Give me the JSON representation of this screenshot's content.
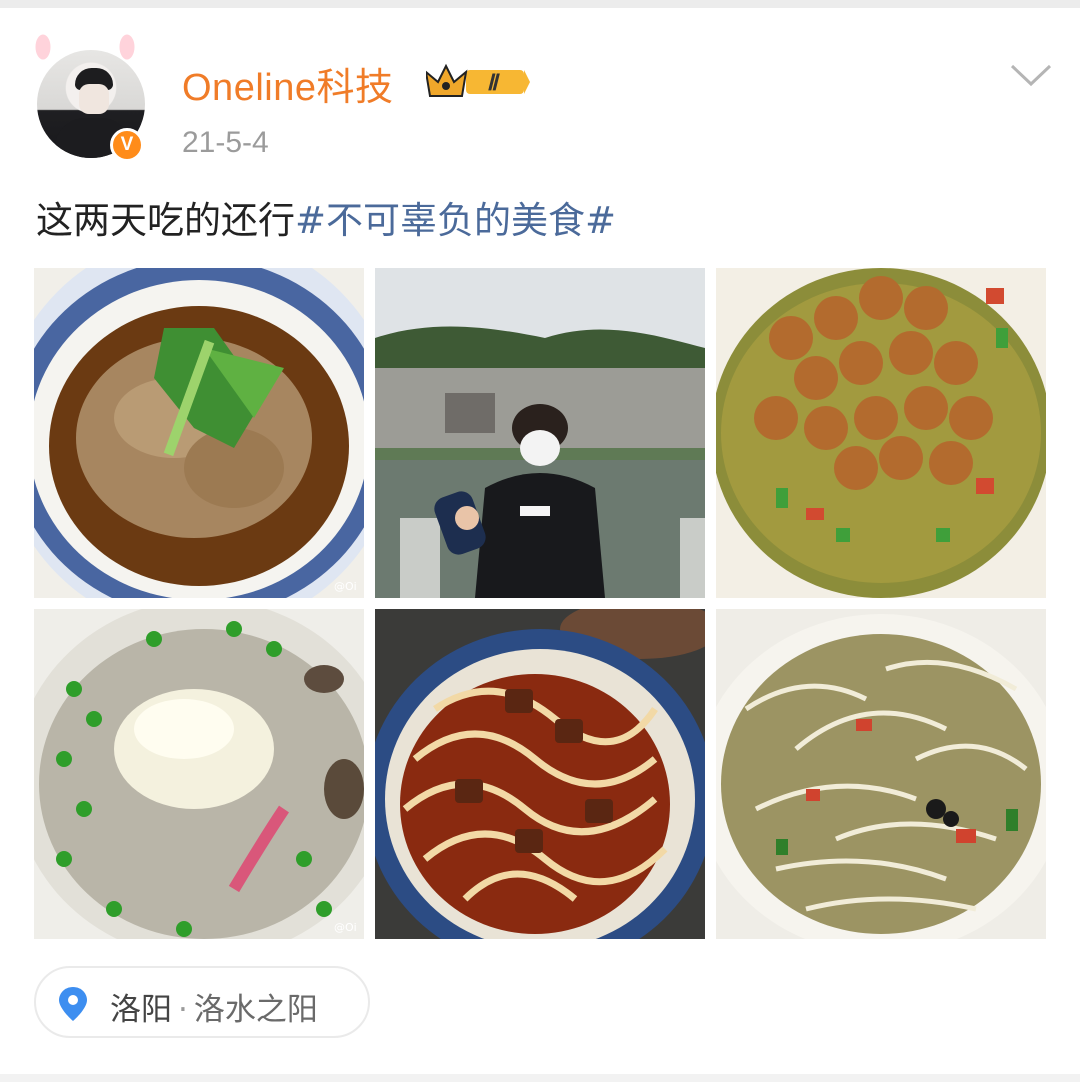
{
  "post": {
    "author": {
      "name": "Oneline科技",
      "level_badge": "Ⅱ",
      "verified_badge": "V"
    },
    "date": "21-5-4",
    "text": "这两天吃的还行",
    "hashtag": "#不可辜负的美食#"
  },
  "location": {
    "city": "洛阳",
    "separator": "·",
    "place": "洛水之阳"
  },
  "photo_watermarks": [
    "@Oi",
    "@Oi",
    "@Oi"
  ],
  "colors": {
    "username": "#f07c28",
    "hashtag": "#4b6a9a",
    "date": "#9b9b9b",
    "verified": "#ff8c1a",
    "location_pin": "#3d8ef0"
  },
  "icons": {
    "more_menu": "chevron-down-icon",
    "location": "location-pin-icon",
    "crown": "crown-icon"
  },
  "photos": [
    {
      "subject": "braised meatball in soup with cilantro"
    },
    {
      "subject": "man with mask at Longmen grottoes"
    },
    {
      "subject": "fried meatballs in vegetable soup"
    },
    {
      "subject": "soup with fungus, noodles and scallions"
    },
    {
      "subject": "beef noodles in chili broth"
    },
    {
      "subject": "shredded tofu vegetable soup"
    }
  ]
}
